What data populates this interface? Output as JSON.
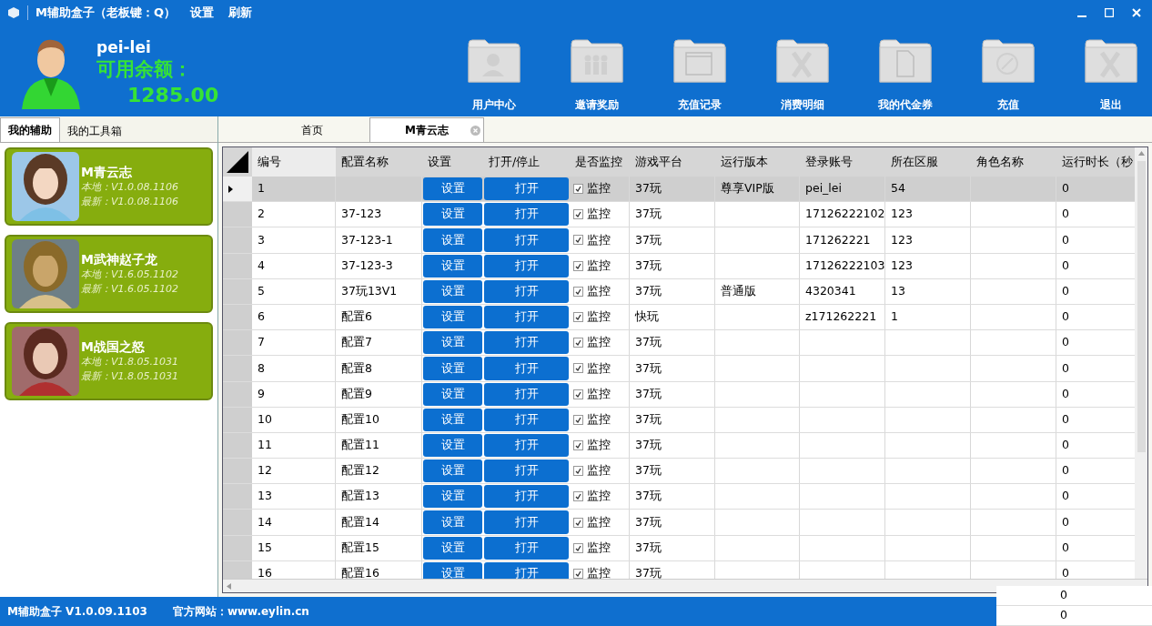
{
  "window": {
    "title": "M辅助盒子（老板键：Q）",
    "menu": [
      "设置",
      "刷新"
    ]
  },
  "user": {
    "name": "pei-lei",
    "balance_label": "可用余额：",
    "balance": "1285.00"
  },
  "toolbar": [
    {
      "label": "用户中心",
      "kind": "user"
    },
    {
      "label": "邀请奖励",
      "kind": "people"
    },
    {
      "label": "充值记录",
      "kind": "window"
    },
    {
      "label": "消费明细",
      "kind": "x"
    },
    {
      "label": "我的代金券",
      "kind": "page"
    },
    {
      "label": "充值",
      "kind": "compass"
    },
    {
      "label": "退出",
      "kind": "x"
    }
  ],
  "side_tabs": [
    {
      "label": "我的辅助",
      "selected": true
    },
    {
      "label": "我的工具箱",
      "selected": false
    }
  ],
  "games": [
    {
      "name": "M青云志",
      "local": "本地：V1.0.08.1106",
      "latest": "最新：V1.0.08.1106",
      "kind": "picture"
    },
    {
      "name": "M武神赵子龙",
      "local": "本地：V1.6.05.1102",
      "latest": "最新：V1.6.05.1102",
      "kind": "picture"
    },
    {
      "name": "M战国之怒",
      "local": "本地：V1.8.05.1031",
      "latest": "最新：V1.8.05.1031",
      "kind": "picture"
    }
  ],
  "main_tabs": [
    {
      "label": "首页",
      "selected": false,
      "closable": false
    },
    {
      "label": "M青云志",
      "selected": true,
      "closable": true
    }
  ],
  "table": {
    "columns": [
      "编号",
      "配置名称",
      "设置",
      "打开/停止",
      "是否监控",
      "游戏平台",
      "运行版本",
      "登录账号",
      "所在区服",
      "角色名称",
      "运行时长（秒"
    ],
    "rows": [
      {
        "id": "1",
        "name": "",
        "settings": "设置",
        "toggle": "打开",
        "monitor": "监控",
        "checked": true,
        "platform": "37玩",
        "version": "尊享VIP版",
        "account": "pei_lei",
        "server": "54",
        "role": "",
        "duration": "0",
        "selected": true
      },
      {
        "id": "2",
        "name": "37-123",
        "settings": "设置",
        "toggle": "打开",
        "monitor": "监控",
        "checked": true,
        "platform": "37玩",
        "version": "",
        "account": "17126222102",
        "server": "123",
        "role": "",
        "duration": "0",
        "selected": false
      },
      {
        "id": "3",
        "name": "37-123-1",
        "settings": "设置",
        "toggle": "打开",
        "monitor": "监控",
        "checked": true,
        "platform": "37玩",
        "version": "",
        "account": "171262221",
        "server": "123",
        "role": "",
        "duration": "0",
        "selected": false
      },
      {
        "id": "4",
        "name": "37-123-3",
        "settings": "设置",
        "toggle": "打开",
        "monitor": "监控",
        "checked": true,
        "platform": "37玩",
        "version": "",
        "account": "17126222103",
        "server": "123",
        "role": "",
        "duration": "0",
        "selected": false
      },
      {
        "id": "5",
        "name": "37玩13V1",
        "settings": "设置",
        "toggle": "打开",
        "monitor": "监控",
        "checked": true,
        "platform": "37玩",
        "version": "普通版",
        "account": "4320341",
        "server": "13",
        "role": "",
        "duration": "0",
        "selected": false
      },
      {
        "id": "6",
        "name": "配置6",
        "settings": "设置",
        "toggle": "打开",
        "monitor": "监控",
        "checked": true,
        "platform": "快玩",
        "version": "",
        "account": "z171262221",
        "server": "1",
        "role": "",
        "duration": "0",
        "selected": false
      },
      {
        "id": "7",
        "name": "配置7",
        "settings": "设置",
        "toggle": "打开",
        "monitor": "监控",
        "checked": true,
        "platform": "37玩",
        "version": "",
        "account": "",
        "server": "",
        "role": "",
        "duration": "0",
        "selected": false
      },
      {
        "id": "8",
        "name": "配置8",
        "settings": "设置",
        "toggle": "打开",
        "monitor": "监控",
        "checked": true,
        "platform": "37玩",
        "version": "",
        "account": "",
        "server": "",
        "role": "",
        "duration": "0",
        "selected": false
      },
      {
        "id": "9",
        "name": "配置9",
        "settings": "设置",
        "toggle": "打开",
        "monitor": "监控",
        "checked": true,
        "platform": "37玩",
        "version": "",
        "account": "",
        "server": "",
        "role": "",
        "duration": "0",
        "selected": false
      },
      {
        "id": "10",
        "name": "配置10",
        "settings": "设置",
        "toggle": "打开",
        "monitor": "监控",
        "checked": true,
        "platform": "37玩",
        "version": "",
        "account": "",
        "server": "",
        "role": "",
        "duration": "0",
        "selected": false
      },
      {
        "id": "11",
        "name": "配置11",
        "settings": "设置",
        "toggle": "打开",
        "monitor": "监控",
        "checked": true,
        "platform": "37玩",
        "version": "",
        "account": "",
        "server": "",
        "role": "",
        "duration": "0",
        "selected": false
      },
      {
        "id": "12",
        "name": "配置12",
        "settings": "设置",
        "toggle": "打开",
        "monitor": "监控",
        "checked": true,
        "platform": "37玩",
        "version": "",
        "account": "",
        "server": "",
        "role": "",
        "duration": "0",
        "selected": false
      },
      {
        "id": "13",
        "name": "配置13",
        "settings": "设置",
        "toggle": "打开",
        "monitor": "监控",
        "checked": true,
        "platform": "37玩",
        "version": "",
        "account": "",
        "server": "",
        "role": "",
        "duration": "0",
        "selected": false
      },
      {
        "id": "14",
        "name": "配置14",
        "settings": "设置",
        "toggle": "打开",
        "monitor": "监控",
        "checked": true,
        "platform": "37玩",
        "version": "",
        "account": "",
        "server": "",
        "role": "",
        "duration": "0",
        "selected": false
      },
      {
        "id": "15",
        "name": "配置15",
        "settings": "设置",
        "toggle": "打开",
        "monitor": "监控",
        "checked": true,
        "platform": "37玩",
        "version": "",
        "account": "",
        "server": "",
        "role": "",
        "duration": "0",
        "selected": false
      },
      {
        "id": "16",
        "name": "配置16",
        "settings": "设置",
        "toggle": "打开",
        "monitor": "监控",
        "checked": true,
        "platform": "37玩",
        "version": "",
        "account": "",
        "server": "",
        "role": "",
        "duration": "0",
        "selected": false
      }
    ],
    "overflow_durations": [
      "0",
      "0"
    ]
  },
  "status_bar": {
    "version": "M辅助盒子 V1.0.09.1103",
    "site": "官方网站：www.eylin.cn"
  }
}
